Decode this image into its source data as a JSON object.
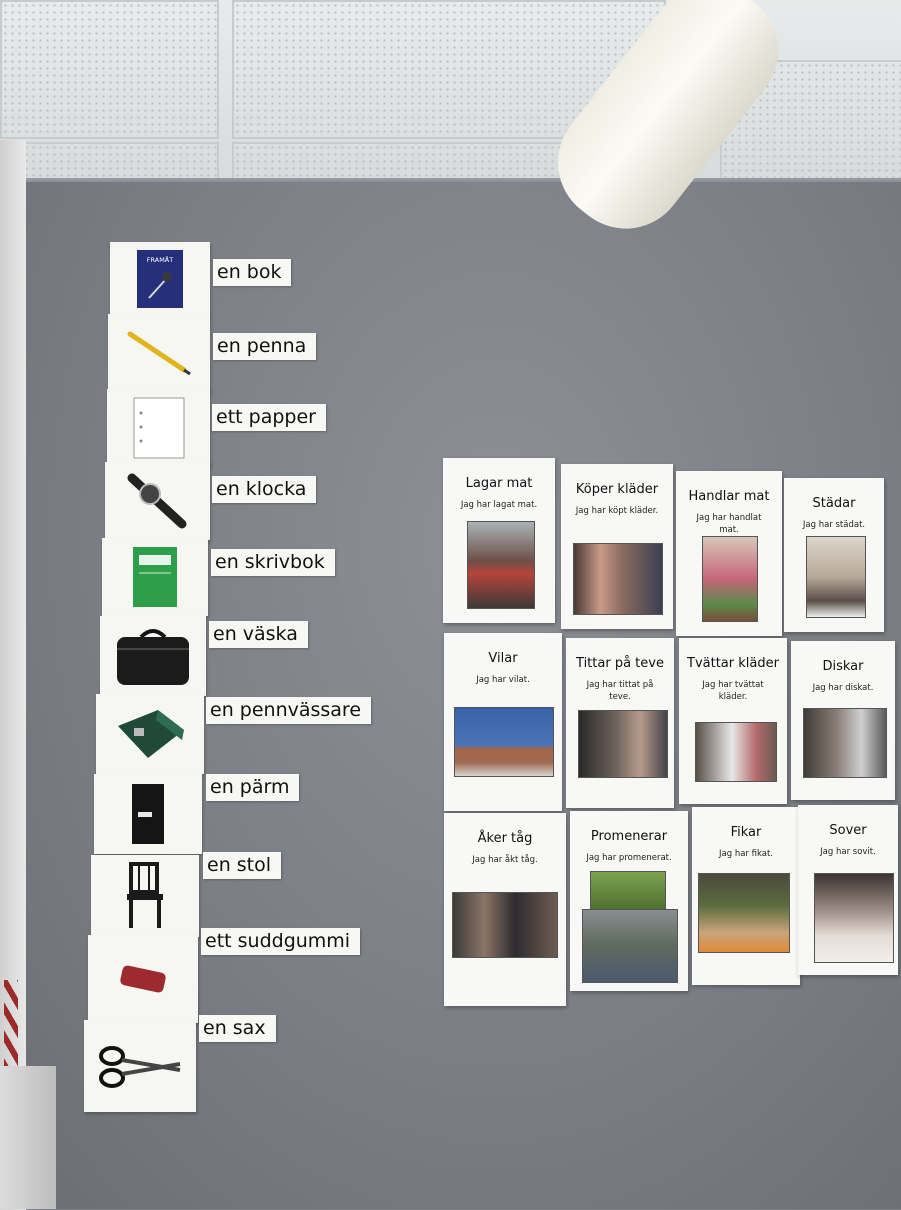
{
  "vocabulary": [
    {
      "word": "en bok",
      "icon": "book-icon"
    },
    {
      "word": "en penna",
      "icon": "pencil-icon"
    },
    {
      "word": "ett papper",
      "icon": "paper-icon"
    },
    {
      "word": "en klocka",
      "icon": "watch-icon"
    },
    {
      "word": "en skrivbok",
      "icon": "notebook-icon"
    },
    {
      "word": "en väska",
      "icon": "bag-icon"
    },
    {
      "word": "en pennvässare",
      "icon": "sharpener-icon"
    },
    {
      "word": "en pärm",
      "icon": "binder-icon"
    },
    {
      "word": "en stol",
      "icon": "chair-icon"
    },
    {
      "word": "ett suddgummi",
      "icon": "eraser-icon"
    },
    {
      "word": "en sax",
      "icon": "scissors-icon"
    }
  ],
  "book_cover_text": "FRAMÅT",
  "activities": [
    {
      "title": "Lagar mat",
      "sentence": "Jag har lagat mat."
    },
    {
      "title": "Köper kläder",
      "sentence": "Jag har köpt kläder."
    },
    {
      "title": "Handlar mat",
      "sentence": "Jag har handlat mat."
    },
    {
      "title": "Städar",
      "sentence": "Jag har städat."
    },
    {
      "title": "Vilar",
      "sentence": "Jag har vilat."
    },
    {
      "title": "Tittar på teve",
      "sentence": "Jag har tittat på teve."
    },
    {
      "title": "Tvättar kläder",
      "sentence": "Jag har tvättat kläder."
    },
    {
      "title": "Diskar",
      "sentence": "Jag har diskat."
    },
    {
      "title": "Åker tåg",
      "sentence": "Jag har åkt tåg."
    },
    {
      "title": "Promenerar",
      "sentence": "Jag har promenerat."
    },
    {
      "title": "Fikar",
      "sentence": "Jag har fikat."
    },
    {
      "title": "Sover",
      "sentence": "Jag har sovit."
    }
  ],
  "colors": {
    "wall": "#7d8086",
    "card": "#f6f6f3",
    "ceiling": "#e3e6e6"
  }
}
